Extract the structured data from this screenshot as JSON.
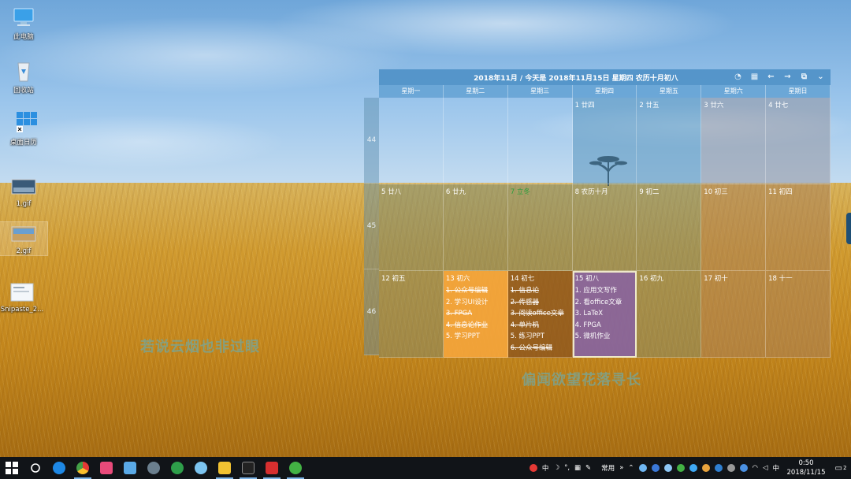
{
  "desktop_icons": [
    {
      "label": "此电脑",
      "icon": "computer-icon"
    },
    {
      "label": "回收站",
      "icon": "recycle-bin-icon"
    },
    {
      "label": "桌面日历",
      "icon": "desktop-calendar-icon"
    },
    {
      "label": "1.gif",
      "icon": "gif-file-icon"
    },
    {
      "label": "2.gif",
      "icon": "gif-file-icon"
    },
    {
      "label": "Snipaste_2...",
      "icon": "image-file-icon"
    }
  ],
  "calendar": {
    "title": "2018年11月 / 今天是 2018年11月15日 星期四 农历十月初八",
    "toolbar_icons": [
      "speed-icon",
      "calendar-icon",
      "arrow-left-icon",
      "arrow-right-icon",
      "window-icon",
      "chevron-down-icon"
    ],
    "weekdays": [
      "星期一",
      "星期二",
      "星期三",
      "星期四",
      "星期五",
      "星期六",
      "星期日"
    ],
    "week_numbers": [
      "44",
      "45",
      "46"
    ],
    "days": [
      {
        "label": "",
        "tasks": []
      },
      {
        "label": "",
        "tasks": []
      },
      {
        "label": "",
        "tasks": []
      },
      {
        "label": "1 廿四",
        "tasks": []
      },
      {
        "label": "2 廿五",
        "tasks": []
      },
      {
        "label": "3 廿六",
        "tasks": []
      },
      {
        "label": "4 廿七",
        "tasks": []
      },
      {
        "label": "5 廿八",
        "tasks": []
      },
      {
        "label": "6 廿九",
        "tasks": []
      },
      {
        "label": "7 立冬",
        "tasks": []
      },
      {
        "label": "8 农历十月",
        "tasks": []
      },
      {
        "label": "9 初二",
        "tasks": []
      },
      {
        "label": "10 初三",
        "tasks": []
      },
      {
        "label": "11 初四",
        "tasks": []
      },
      {
        "label": "12 初五",
        "tasks": []
      },
      {
        "label": "13 初六",
        "tasks": [
          {
            "text": "1. 公众号编辑",
            "done": true
          },
          {
            "text": "2. 学习UI设计",
            "done": false
          },
          {
            "text": "3. FPGA",
            "done": true
          },
          {
            "text": "4. 信息论作业",
            "done": true
          },
          {
            "text": "5. 学习PPT",
            "done": false
          }
        ]
      },
      {
        "label": "14 初七",
        "tasks": [
          {
            "text": "1. 信息论",
            "done": true
          },
          {
            "text": "2. 传感器",
            "done": true
          },
          {
            "text": "3. 阅读office文章",
            "done": true
          },
          {
            "text": "4. 单片机",
            "done": true
          },
          {
            "text": "5. 练习PPT",
            "done": false
          },
          {
            "text": "6. 公众号编辑",
            "done": true
          }
        ]
      },
      {
        "label": "15 初八",
        "tasks": [
          {
            "text": "1. 应用文写作",
            "done": false
          },
          {
            "text": "2. 看office文章",
            "done": false
          },
          {
            "text": "3. LaTeX",
            "done": false
          },
          {
            "text": "4. FPGA",
            "done": false
          },
          {
            "text": "5. 微机作业",
            "done": false
          }
        ]
      },
      {
        "label": "16 初九",
        "tasks": []
      },
      {
        "label": "17 初十",
        "tasks": []
      },
      {
        "label": "18 十一",
        "tasks": []
      }
    ],
    "highlight_color": "#2a9d3c"
  },
  "quotes": {
    "left": "若说云烟也非过眼",
    "right": "偏闻欲望花落寻长"
  },
  "taskbar": {
    "pinned": [
      "start-icon",
      "search-icon",
      "edge-icon",
      "chrome-icon",
      "media-icon",
      "notes-icon",
      "app-icon",
      "sync-icon",
      "cloud-icon",
      "explorer-icon",
      "terminal-icon",
      "typora-icon",
      "wechat-icon"
    ],
    "ime": "中",
    "tray_label": "常用",
    "tray_arrow": "»",
    "clock_time": "0:50",
    "clock_date": "2018/11/15",
    "notifications": "2"
  }
}
